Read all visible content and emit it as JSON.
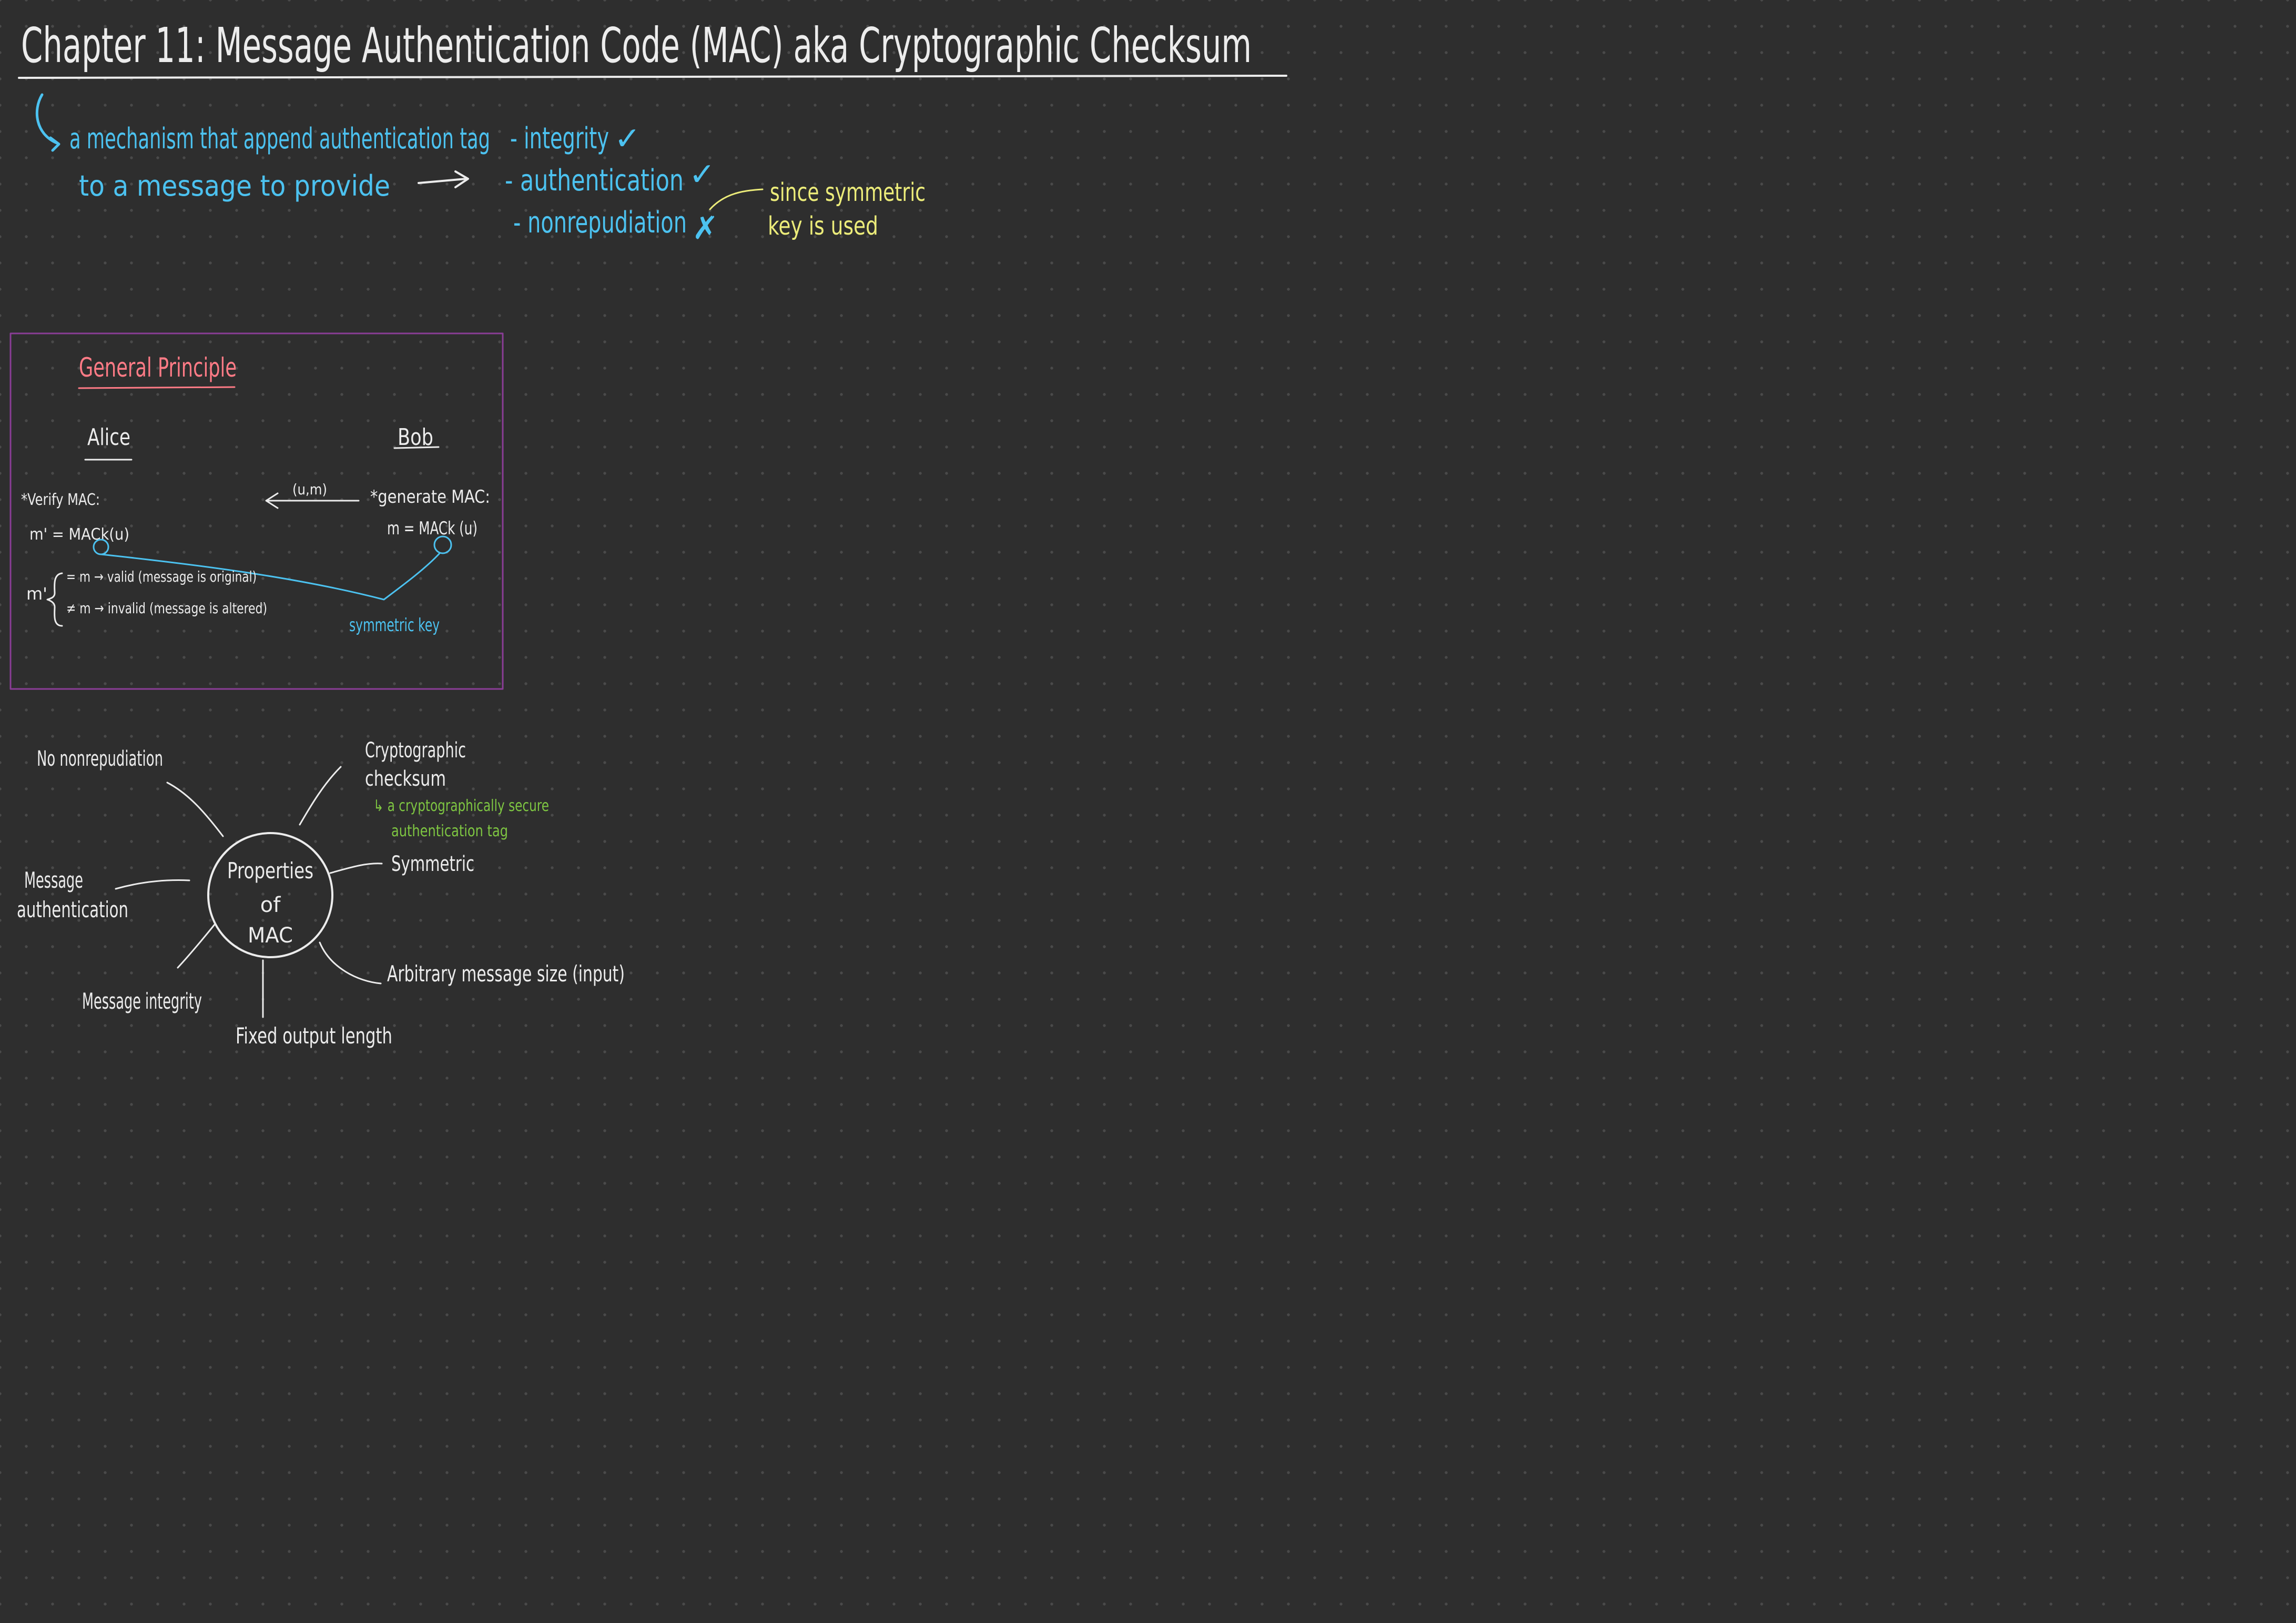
{
  "header": {
    "title": "Chapter 11: Message Authentication Code (MAC) aka Cryptographic Checksum"
  },
  "definition": {
    "line1": "a mechanism that append authentication tag",
    "line2": "to a message to provide",
    "items": [
      {
        "text": "- integrity",
        "mark": "✓"
      },
      {
        "text": "- authentication",
        "mark": "✓"
      },
      {
        "text": "- nonrepudiation",
        "mark": "✗"
      }
    ],
    "note_line1": "since symmetric",
    "note_line2": "key is used"
  },
  "general_principle": {
    "heading": "General Principle",
    "alice": "Alice",
    "bob": "Bob",
    "transmit": "(u,m)",
    "verify_label": "*Verify MAC:",
    "verify_formula": "m' = MACk(u)",
    "generate_label": "*generate MAC:",
    "generate_formula": "m = MACk (u)",
    "compare_prefix": "m'",
    "valid_case": "= m → valid (message is original)",
    "invalid_case": "≠ m → invalid (message is altered)",
    "key_label": "symmetric key"
  },
  "mindmap": {
    "center_line1": "Properties",
    "center_line2": "of",
    "center_line3": "MAC",
    "nonrepudiation": "No nonrepudiation",
    "crypto_line1": "Cryptographic",
    "crypto_line2": "checksum",
    "crypto_note_line1": "↳ a cryptographically secure",
    "crypto_note_line2": "authentication tag",
    "symmetric": "Symmetric",
    "auth_line1": "Message",
    "auth_line2": "authentication",
    "arbitrary": "Arbitrary message size (input)",
    "integrity": "Message integrity",
    "fixed": "Fixed output length"
  }
}
